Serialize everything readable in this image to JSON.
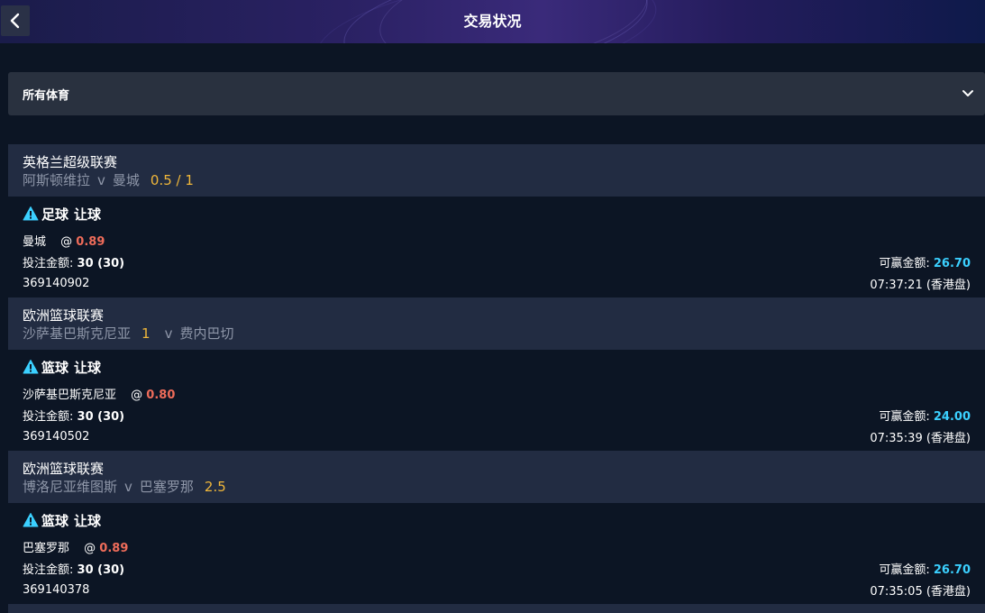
{
  "header": {
    "title": "交易状况"
  },
  "filter": {
    "label": "所有体育"
  },
  "colors": {
    "accent_odds": "#ef6c5a",
    "accent_win": "#3bd0ff",
    "accent_hcap": "#f0b73a"
  },
  "labels": {
    "stake": "投注金额:",
    "towin": "可赢金额:"
  },
  "bets": [
    {
      "league": "英格兰超级联赛",
      "home": "阿斯顿维拉",
      "vs": "v",
      "away": "曼城",
      "handicap": "0.5 / 1",
      "handicap_pos": "after",
      "sport": "足球",
      "market": "让球",
      "pick": "曼城",
      "at": "@",
      "odds": "0.89",
      "stake": "30 (30)",
      "towin": "26.70",
      "ref": "369140902",
      "time": "07:37:21 (香港盘)"
    },
    {
      "league": "欧洲篮球联赛",
      "home": "沙萨基巴斯克尼亚",
      "vs": "v",
      "away": "费内巴切",
      "handicap": "1",
      "handicap_pos": "middle",
      "sport": "篮球",
      "market": "让球",
      "pick": "沙萨基巴斯克尼亚",
      "at": "@",
      "odds": "0.80",
      "stake": "30 (30)",
      "towin": "24.00",
      "ref": "369140502",
      "time": "07:35:39 (香港盘)"
    },
    {
      "league": "欧洲篮球联赛",
      "home": "博洛尼亚维图斯",
      "vs": "v",
      "away": "巴塞罗那",
      "handicap": "2.5",
      "handicap_pos": "after",
      "sport": "篮球",
      "market": "让球",
      "pick": "巴塞罗那",
      "at": "@",
      "odds": "0.89",
      "stake": "30 (30)",
      "towin": "26.70",
      "ref": "369140378",
      "time": "07:35:05 (香港盘)"
    }
  ]
}
